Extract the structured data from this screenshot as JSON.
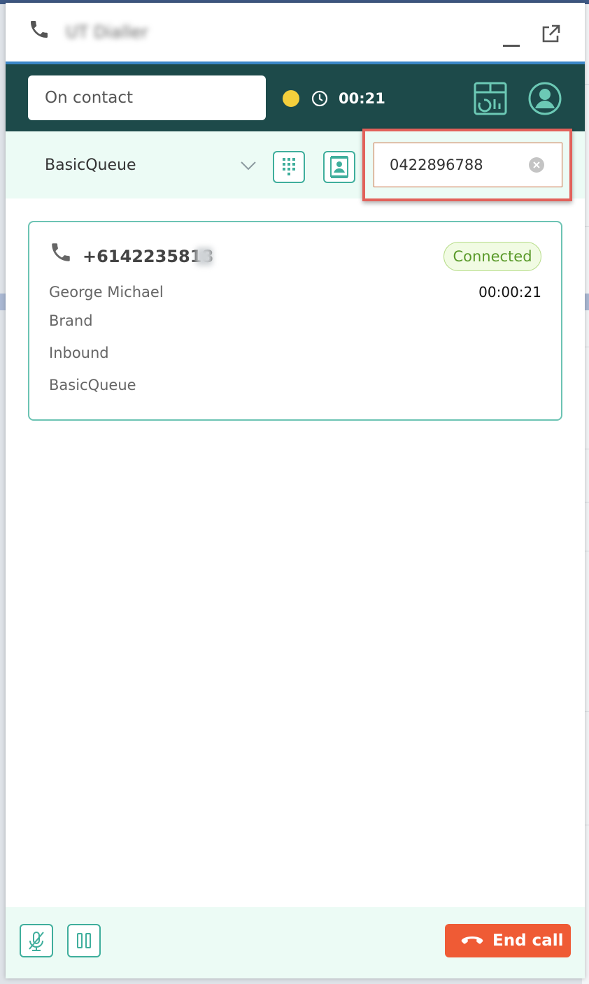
{
  "window": {
    "app_title": "UT Dialler",
    "icons": {
      "phone": "phone-icon",
      "minimize": "minimize-icon",
      "popout": "popout-icon"
    }
  },
  "agent": {
    "status": "On contact",
    "status_color": "#f5cf3c",
    "timer": "00:21",
    "icons": {
      "clock": "clock-icon",
      "dashboard": "dashboard-icon",
      "profile": "user-profile-icon"
    }
  },
  "controls": {
    "queue": "BasicQueue",
    "dial_number": "0422896788",
    "icons": {
      "dialpad": "dialpad-icon",
      "contacts": "contacts-icon",
      "clear": "clear-icon"
    }
  },
  "contact": {
    "number": "+6142235818",
    "status": "Connected",
    "duration": "00:00:21",
    "name": "George Michael",
    "brand": "Brand",
    "direction": "Inbound",
    "queue": "BasicQueue"
  },
  "footer": {
    "end_call_label": "End call",
    "icons": {
      "mute": "mute-icon",
      "hold": "hold-icon",
      "hangup": "hangup-icon"
    }
  },
  "colors": {
    "header": "#1d4a4a",
    "accent": "#3fae9c",
    "end_call": "#ef5b35",
    "highlight": "#e2615a",
    "connected": "#5a9a2a"
  }
}
